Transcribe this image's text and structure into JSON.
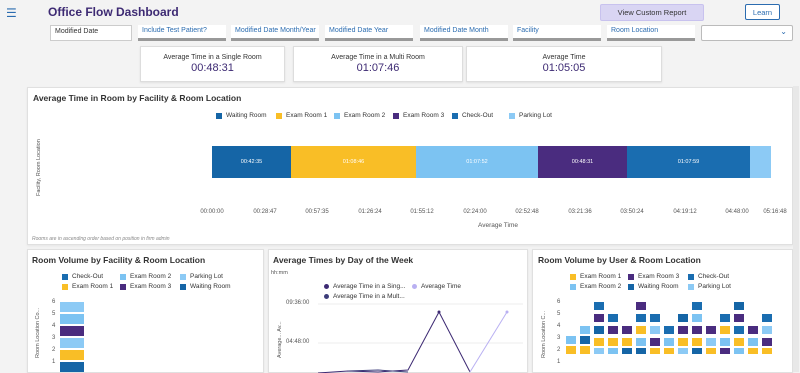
{
  "header": {
    "menu_icon": "hamburger-menu-icon",
    "title": "Office Flow Dashboard",
    "view_report_label": "View Custom Report",
    "learn_label": "Learn"
  },
  "filters": {
    "items": [
      "Modified Date",
      "Include Test Patient?",
      "Modified Date Month/Year",
      "Modified Date Year",
      "Modified Date Month",
      "Facility",
      "Room Location"
    ],
    "select_value": "",
    "chevron_icon": "chevron-down-icon"
  },
  "kpis": [
    {
      "label": "Average Time in a Single Room",
      "value": "00:48:31"
    },
    {
      "label": "Average Time in a Multi Room",
      "value": "01:07:46"
    },
    {
      "label": "Average Time",
      "value": "01:05:05"
    }
  ],
  "main_chart": {
    "title": "Average Time in Room by Facility & Room Location",
    "ylabel": "Facility, Room Location",
    "xlabel": "Average Time",
    "note": "Rooms are in ascending order based on position in firm admin",
    "legend": [
      {
        "name": "Waiting Room",
        "color": "#1565a6"
      },
      {
        "name": "Exam Room 1",
        "color": "#f9be26"
      },
      {
        "name": "Exam Room 2",
        "color": "#7cc3f2"
      },
      {
        "name": "Exam Room 3",
        "color": "#4a2c7f"
      },
      {
        "name": "Check-Out",
        "color": "#1a6db0"
      },
      {
        "name": "Parking Lot",
        "color": "#8ccaf5"
      }
    ],
    "segments": [
      {
        "label": "00:42:35",
        "color": "#1565a6"
      },
      {
        "label": "01:08:46",
        "color": "#f9be26"
      },
      {
        "label": "01:07:52",
        "color": "#7cc3f2"
      },
      {
        "label": "00:48:31",
        "color": "#4a2c7f"
      },
      {
        "label": "01:07:59",
        "color": "#1a6db0"
      },
      {
        "label": "",
        "color": "#8ccaf5"
      }
    ],
    "ticks": [
      "00:00:00",
      "00:28:47",
      "00:57:35",
      "01:26:24",
      "01:55:12",
      "02:24:00",
      "02:52:48",
      "03:21:36",
      "03:50:24",
      "04:19:12",
      "04:48:00",
      "05:16:48"
    ]
  },
  "room_volume_facility": {
    "title": "Room Volume by Facility & Room Location",
    "ylabel": "Room Location Co...",
    "yticks": [
      "6",
      "5",
      "4",
      "3",
      "2",
      "1"
    ],
    "legend": [
      {
        "name": "Check-Out",
        "color": "#1a6db0"
      },
      {
        "name": "Exam Room 2",
        "color": "#7cc3f2"
      },
      {
        "name": "Parking Lot",
        "color": "#8ccaf5"
      },
      {
        "name": "Exam Room 1",
        "color": "#f9be26"
      },
      {
        "name": "Exam Room 3",
        "color": "#4a2c7f"
      },
      {
        "name": "Waiting Room",
        "color": "#1565a6"
      }
    ]
  },
  "avg_times_day": {
    "title": "Average Times by Day of the Week",
    "unit": "hh:mm",
    "ylabel": "Average... Av...",
    "yticks": [
      "09:36:00",
      "04:48:00"
    ],
    "legend": [
      {
        "name": "Average Time in a Sing...",
        "color": "#3d2a73"
      },
      {
        "name": "Average Time",
        "color": "#b9b0f2"
      },
      {
        "name": "Average Time in a Mult...",
        "color": "#3d3d7a"
      }
    ]
  },
  "room_volume_user": {
    "title": "Room Volume by User & Room Location",
    "ylabel": "Room Location C...",
    "yticks": [
      "6",
      "5",
      "4",
      "3",
      "2",
      "1"
    ],
    "legend": [
      {
        "name": "Exam Room 1",
        "color": "#f9be26"
      },
      {
        "name": "Exam Room 3",
        "color": "#4a2c7f"
      },
      {
        "name": "Check-Out",
        "color": "#1a6db0"
      },
      {
        "name": "Exam Room 2",
        "color": "#7cc3f2"
      },
      {
        "name": "Waiting Room",
        "color": "#1565a6"
      },
      {
        "name": "Parking Lot",
        "color": "#8ccaf5"
      }
    ]
  }
}
